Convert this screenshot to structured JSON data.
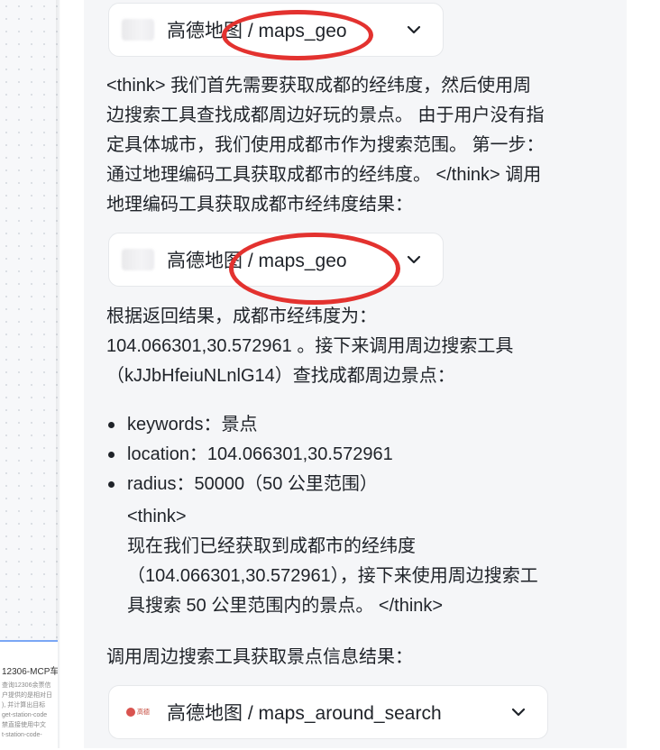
{
  "sidebar_card": {
    "title": "12306-MCP车",
    "lines": [
      "查询12306余票信",
      "户提供的是相对日",
      "), 并计算出目标",
      "get-station-code",
      "禁直接使用中文",
      "t-station-code-"
    ]
  },
  "tool_calls": [
    {
      "label": "高德地图 / maps_geo"
    },
    {
      "label": "高德地图 / maps_geo"
    },
    {
      "label": "高德地图 / maps_around_search",
      "logo_text": "高德"
    }
  ],
  "message": {
    "para1": [
      "<think> 我们首先需要获取成都的经纬度，然后使用周",
      "边搜索工具查找成都周边好玩的景点。 由于用户没有指",
      "定具体城市，我们使用成都市作为搜索范围。 第一步：",
      "通过地理编码工具获取成都市的经纬度。 </think> 调用",
      "地理编码工具获取成都市经纬度结果："
    ],
    "para2": [
      "根据返回结果，成都市经纬度为：",
      "104.066301,30.572961 。接下来调用周边搜索工具",
      "（kJJbHfeiuNLnlG14）查找成都周边景点："
    ],
    "params": [
      "keywords：景点",
      "location：104.066301,30.572961",
      "radius：50000（50 公里范围）"
    ],
    "think_block": [
      "<think>",
      "现在我们已经获取到成都市的经纬度",
      "（104.066301,30.572961），接下来使用周边搜索工",
      "具搜索 50 公里范围内的景点。 </think>"
    ],
    "para3": "调用周边搜索工具获取景点信息结果："
  },
  "colors": {
    "annotation": "#e3322f",
    "panel": "#f5f6f8"
  },
  "icons": [
    "chevron-down-icon",
    "tool-logo-icon"
  ]
}
